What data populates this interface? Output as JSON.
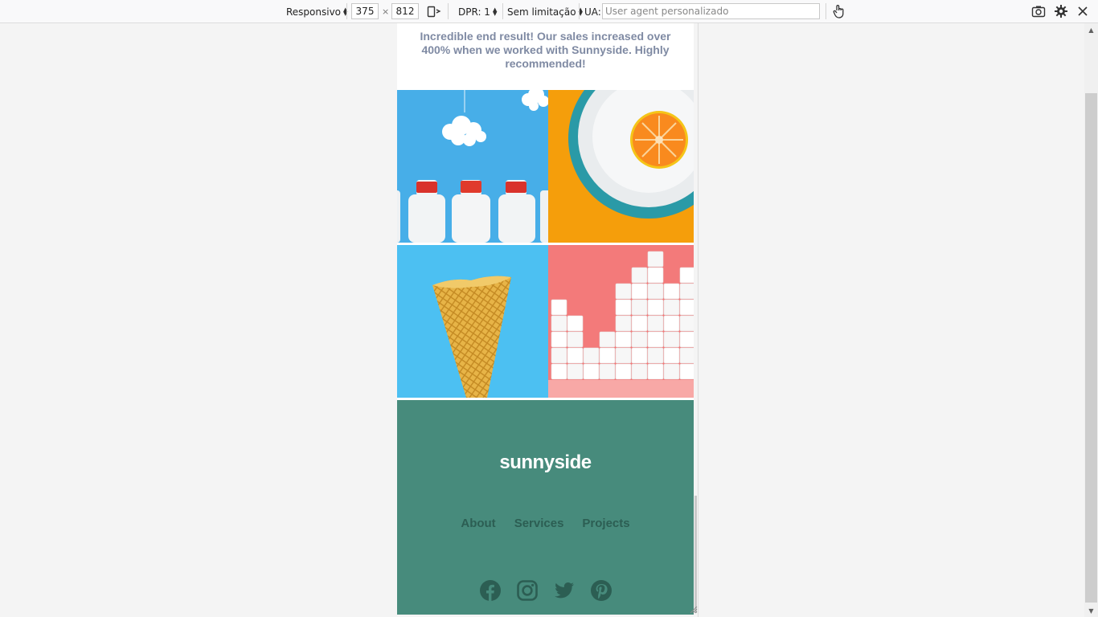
{
  "toolbar": {
    "device_label": "Responsivo",
    "width_value": "375",
    "times": "×",
    "height_value": "812",
    "dpr_label": "DPR: 1",
    "throttle_label": "Sem limitação",
    "ua_label": "UA:",
    "ua_placeholder": "User agent personalizado",
    "icons": [
      "rotate-icon",
      "touch-icon",
      "screenshot-icon",
      "settings-icon",
      "close-icon"
    ]
  },
  "page": {
    "testimonial": "Incredible end result! Our sales increased over 400% when we worked with Sunnyside. Highly recommended!",
    "gallery": [
      "milk-bottles",
      "orange-on-plate",
      "ice-cream-cone",
      "sugar-cubes"
    ],
    "footer": {
      "logo": "sunnyside",
      "nav": [
        "About",
        "Services",
        "Projects"
      ],
      "socials": [
        "facebook-icon",
        "instagram-icon",
        "twitter-icon",
        "pinterest-icon"
      ],
      "bg_color": "#478b7c",
      "link_color": "#2c5e53"
    }
  }
}
